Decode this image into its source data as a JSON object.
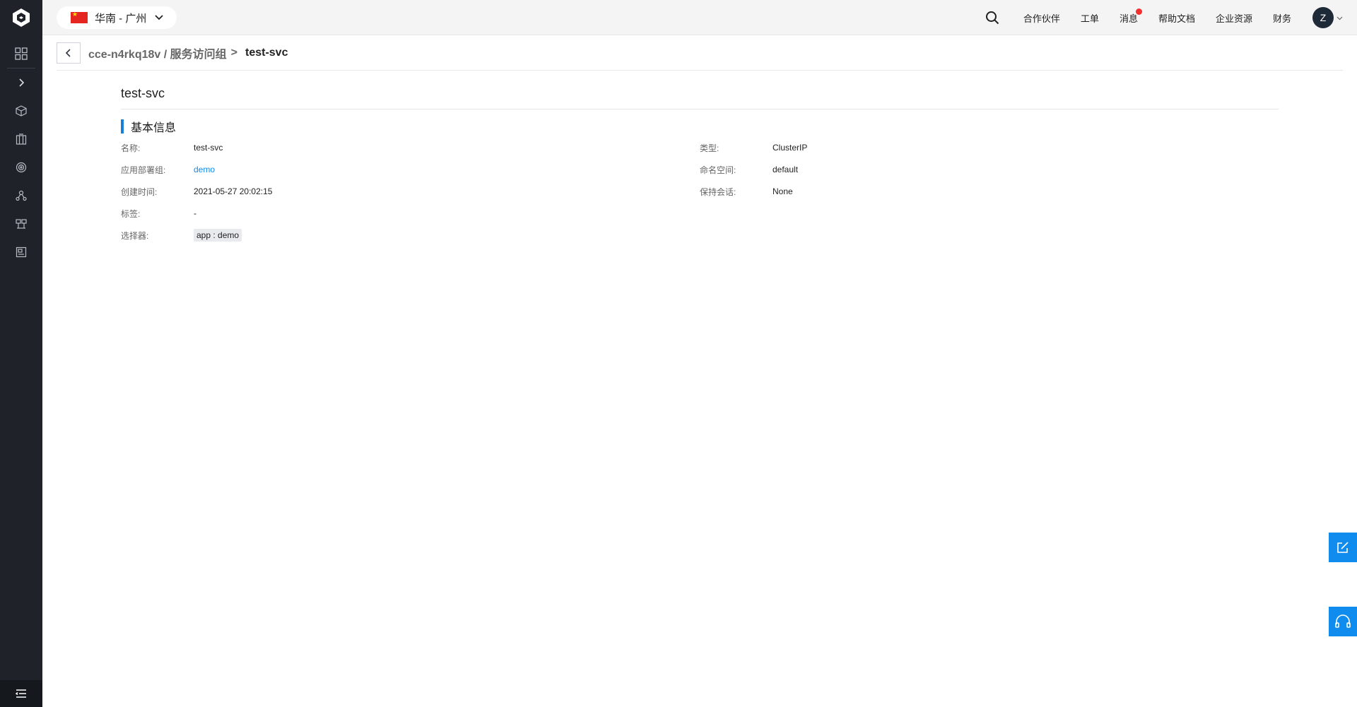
{
  "topbar": {
    "region": "华南 - 广州",
    "nav": [
      {
        "label": "合作伙伴"
      },
      {
        "label": "工单"
      },
      {
        "label": "消息"
      },
      {
        "label": "帮助文档"
      },
      {
        "label": "企业资源"
      },
      {
        "label": "财务"
      }
    ],
    "avatar_letter": "Z"
  },
  "breadcrumb": {
    "parent": "cce-n4rkq18v / 服务访问组",
    "separator": ">",
    "current": "test-svc"
  },
  "page": {
    "title": "test-svc",
    "section_title": "基本信息",
    "left_fields": [
      {
        "key": "名称:",
        "value": "test-svc"
      },
      {
        "key": "应用部署组:",
        "value": "demo"
      },
      {
        "key": "创建时间:",
        "value": "2021-05-27 20:02:15"
      },
      {
        "key": "标签:",
        "value": "-"
      },
      {
        "key": "选择器:",
        "value": "app : demo"
      }
    ],
    "right_fields": [
      {
        "key": "类型:",
        "value": "ClusterIP"
      },
      {
        "key": "命名空间:",
        "value": "default"
      },
      {
        "key": "保持会话:",
        "value": "None"
      }
    ]
  },
  "icons": {
    "logo": "cloud-logo-icon",
    "sidebar": [
      "dashboard-grid-icon",
      "expand-chevron-icon",
      "cube-icon",
      "building-icon",
      "target-icon",
      "nodes-icon",
      "network-icon",
      "storage-icon"
    ],
    "sidebar_bottom": "menu-collapse-icon",
    "float": [
      "edit-feedback-icon",
      "headset-support-icon"
    ]
  },
  "colors": {
    "accent": "#108cee",
    "sidebar_bg": "#1f2329",
    "notification_dot": "#f23030"
  }
}
